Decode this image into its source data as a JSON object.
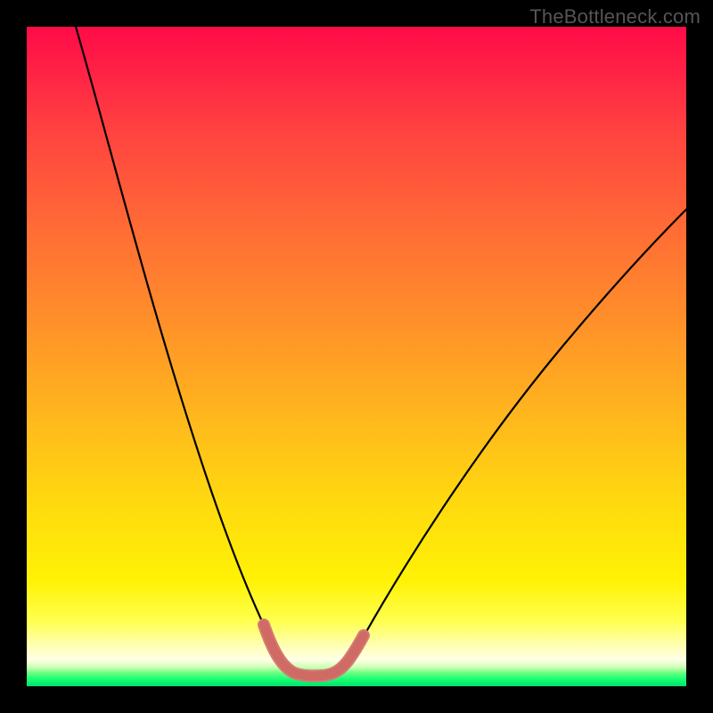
{
  "watermark": "TheBottleneck.com",
  "chart_data": {
    "type": "line",
    "title": "",
    "xlabel": "",
    "ylabel": "",
    "xlim": [
      0,
      100
    ],
    "ylim": [
      0,
      100
    ],
    "series": [
      {
        "name": "bottleneck-curve",
        "x": [
          5,
          10,
          15,
          20,
          25,
          28,
          31,
          34,
          36,
          38,
          40,
          42,
          44,
          46,
          50,
          55,
          60,
          65,
          70,
          75,
          80,
          85,
          90,
          95,
          100
        ],
        "values": [
          100,
          90,
          78,
          65,
          50,
          40,
          30,
          20,
          12,
          6,
          3,
          2,
          2,
          3,
          6,
          12,
          20,
          28,
          36,
          43,
          50,
          56,
          61,
          65,
          68
        ]
      }
    ],
    "highlight_range_x": [
      35,
      47
    ],
    "annotations": []
  },
  "colors": {
    "background_black": "#000000",
    "watermark": "#555558",
    "curve": "#000000",
    "highlight": "#d57a76",
    "gradient_top": "#ff0b47",
    "gradient_bottom": "#00e06a"
  }
}
